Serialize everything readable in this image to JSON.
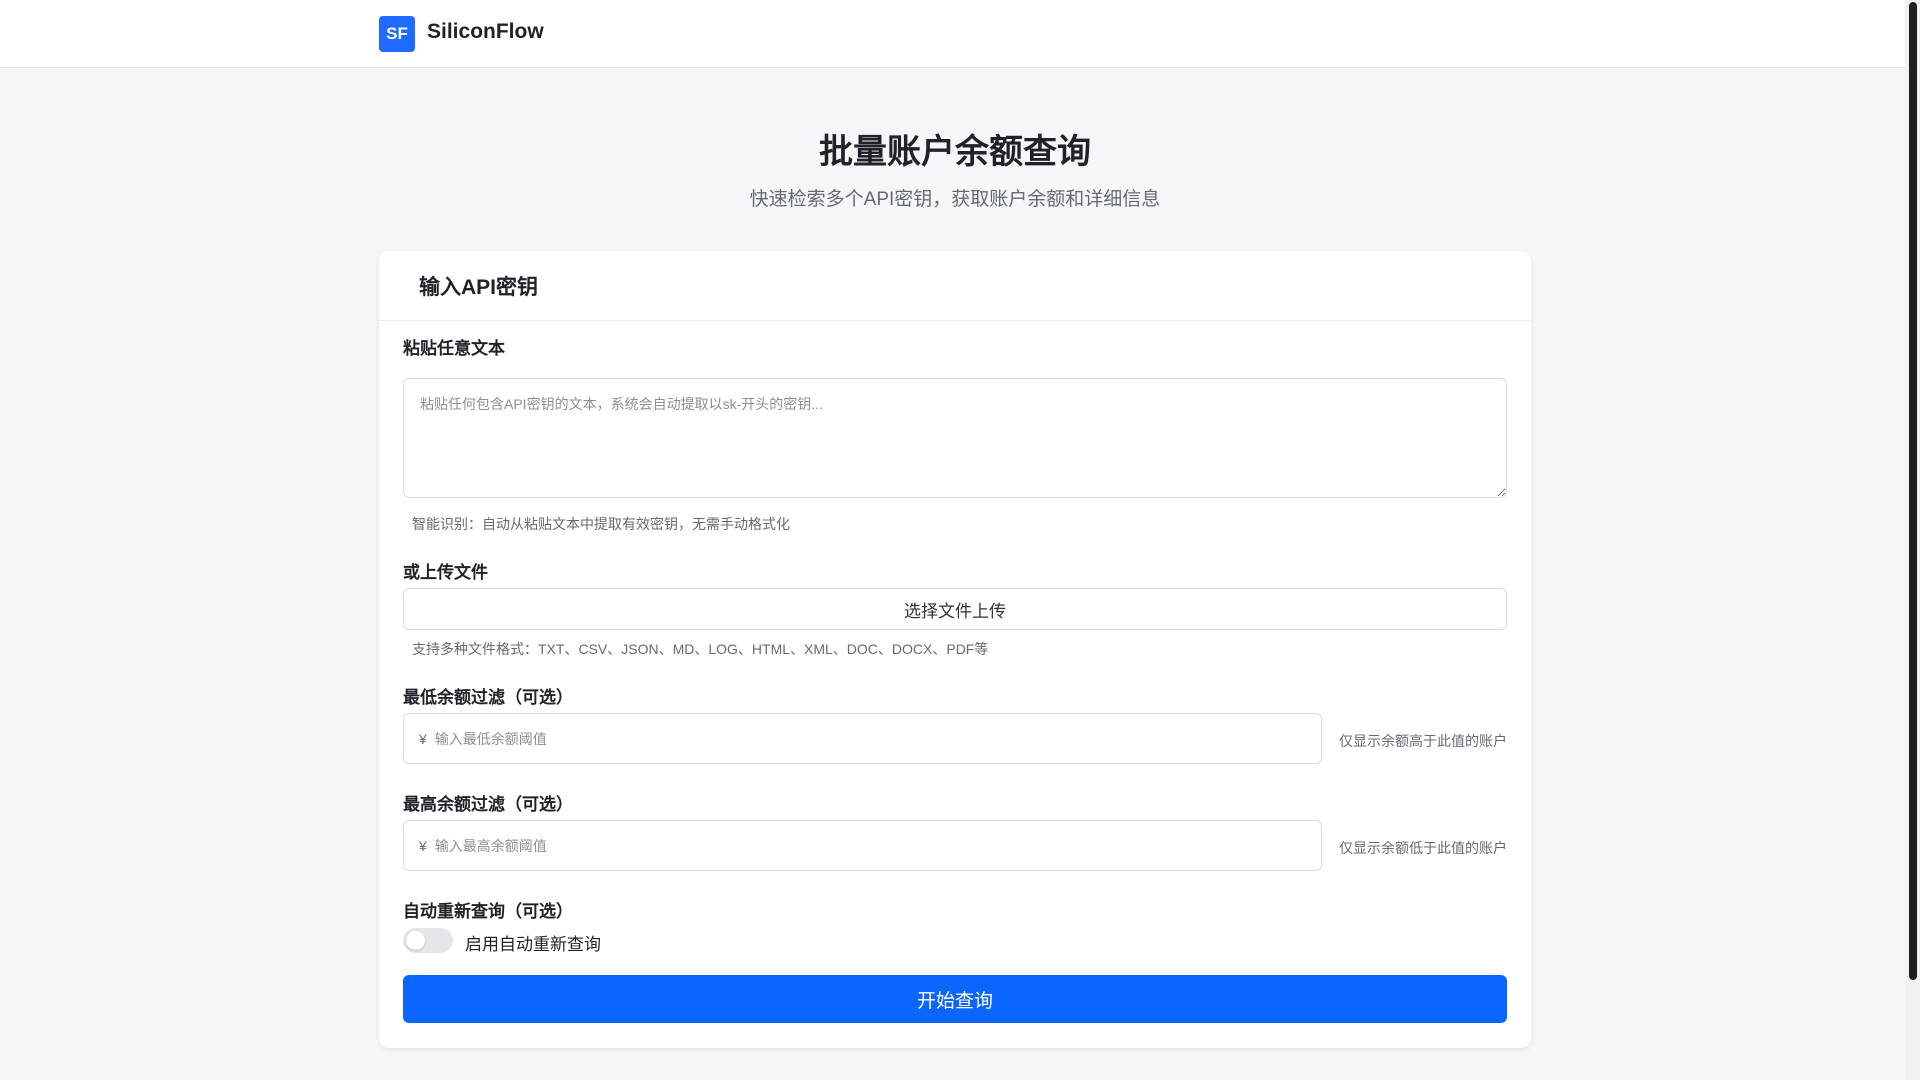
{
  "header": {
    "logo_text": "SF",
    "brand": "SiliconFlow"
  },
  "page": {
    "title": "批量账户余额查询",
    "subtitle": "快速检索多个API密钥，获取账户余额和详细信息"
  },
  "card": {
    "title": "输入API密钥",
    "paste": {
      "label": "粘贴任意文本",
      "placeholder": "粘贴任何包含API密钥的文本，系统会自动提取以sk-开头的密钥...",
      "hint": "智能识别：自动从粘贴文本中提取有效密钥，无需手动格式化"
    },
    "upload": {
      "label": "或上传文件",
      "button": "选择文件上传",
      "hint": "支持多种文件格式：TXT、CSV、JSON、MD、LOG、HTML、XML、DOC、DOCX、PDF等"
    },
    "min_filter": {
      "label": "最低余额过滤（可选）",
      "currency": "¥",
      "placeholder": "输入最低余额阈值",
      "hint": "仅显示余额高于此值的账户"
    },
    "max_filter": {
      "label": "最高余额过滤（可选）",
      "currency": "¥",
      "placeholder": "输入最高余额阈值",
      "hint": "仅显示余额低于此值的账户"
    },
    "auto_requery": {
      "label": "自动重新查询（可选）",
      "toggle_label": "启用自动重新查询",
      "enabled": false
    },
    "submit": "开始查询"
  },
  "colors": {
    "primary": "#0a66ff",
    "logo": "#1f6bff"
  }
}
